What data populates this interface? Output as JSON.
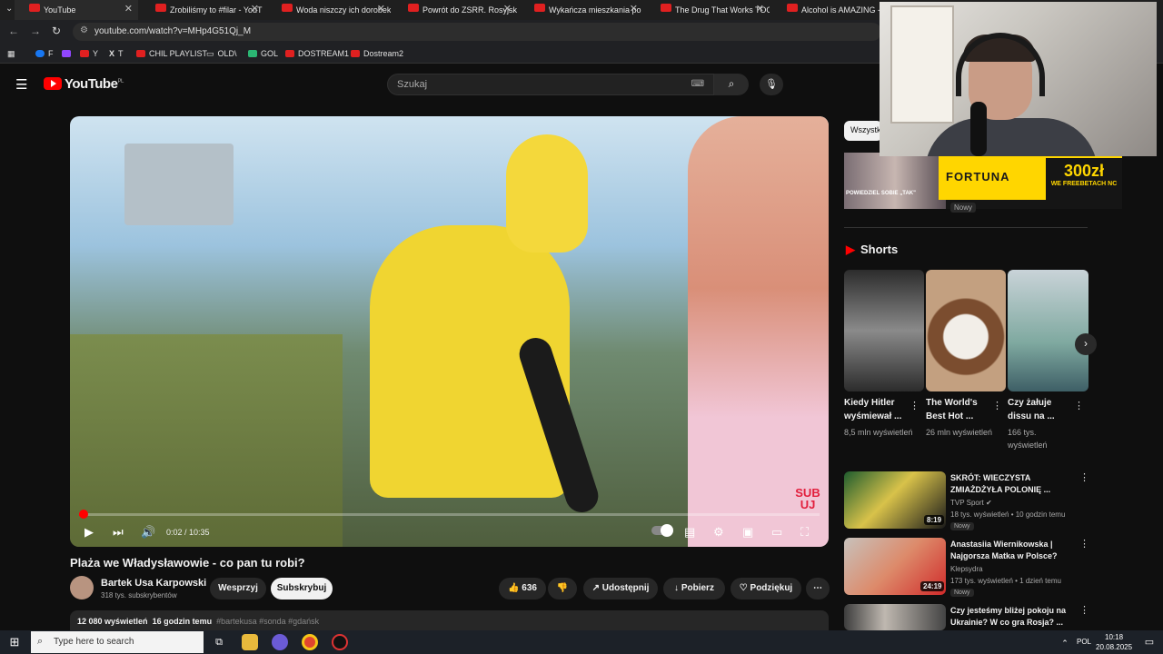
{
  "browser": {
    "tabs": [
      {
        "label": "YouTube",
        "active": true
      },
      {
        "label": "Zrobiliśmy to #filar - YouT"
      },
      {
        "label": "Woda niszczy ich dorobek"
      },
      {
        "label": "Powrót do ZSRR. Rosyjska"
      },
      {
        "label": "Wykańcza mieszkania po"
      },
      {
        "label": "The Drug That Works TOO"
      },
      {
        "label": "Alcohol is AMAZING - Ve"
      }
    ],
    "url": "youtube.com/watch?v=MHp4G51Qj_M",
    "bookmarks": [
      "F",
      "",
      "Y",
      "T",
      "CHIL PLAYLIST",
      "OLD\\",
      "GOL",
      "DOSTREAM1",
      "Dostream2"
    ]
  },
  "header": {
    "logo": "YouTube",
    "logo_region": "PL",
    "search_placeholder": "Szukaj"
  },
  "player": {
    "time": "0:02 / 10:35",
    "progress": 0.003,
    "watermark": "SUB UJ"
  },
  "video": {
    "title": "Plaża we Władysławowie - co pan tu robi?",
    "channel": "Bartek Usa Karpowski",
    "subscribers": "318 tys. subskrybentów",
    "join_label": "Wesprzyj",
    "subscribe_label": "Subskrybuj",
    "likes": "636",
    "share_label": "Udostępnij",
    "download_label": "Pobierz",
    "thanks_label": "Podziękuj",
    "views": "12 080 wyświetleń",
    "age": "16 godzin temu",
    "tags": "#bartekusa #sonda #gdańsk"
  },
  "sidebar": {
    "chip_all": "Wszystk",
    "ad": {
      "brand": "FORTUNA",
      "amount": "300zł",
      "sub": "WE FREEBETACH NC",
      "thumb_text": "POWIEDZIEL SOBIE „TAK\"",
      "new": "Nowy"
    },
    "shorts_heading": "Shorts",
    "shorts": [
      {
        "title": "Kiedy Hitler wyśmiewał ...",
        "views": "8,5 mln wyświetleń"
      },
      {
        "title": "The World's Best Hot ...",
        "views": "26 mln wyświetleń"
      },
      {
        "title": "Czy żałuje dissu na ...",
        "views": "166 tys. wyświetleń"
      }
    ],
    "recs": [
      {
        "title": "SKRÓT: WIECZYSTA ZMIAŻDŻYŁA POLONIĘ ...",
        "channel": "TVP Sport",
        "meta": "18 tys. wyświetleń • 10 godzin temu",
        "new": "Nowy",
        "duration": "8:19"
      },
      {
        "title": "Anastasiia Wiernikowska | Najgorsza Matka w Polsce?",
        "channel": "Klepsydra",
        "meta": "173 tys. wyświetleń • 1 dzień temu",
        "new": "Nowy",
        "duration": "24:19"
      },
      {
        "title": "Czy jesteśmy bliżej pokoju na Ukrainie? W co gra Rosja? ...",
        "channel": "",
        "meta": "",
        "new": "",
        "duration": ""
      }
    ]
  },
  "taskbar": {
    "search_placeholder": "Type here to search",
    "lang": "POL",
    "time": "10:18",
    "date": "20.08.2025"
  }
}
